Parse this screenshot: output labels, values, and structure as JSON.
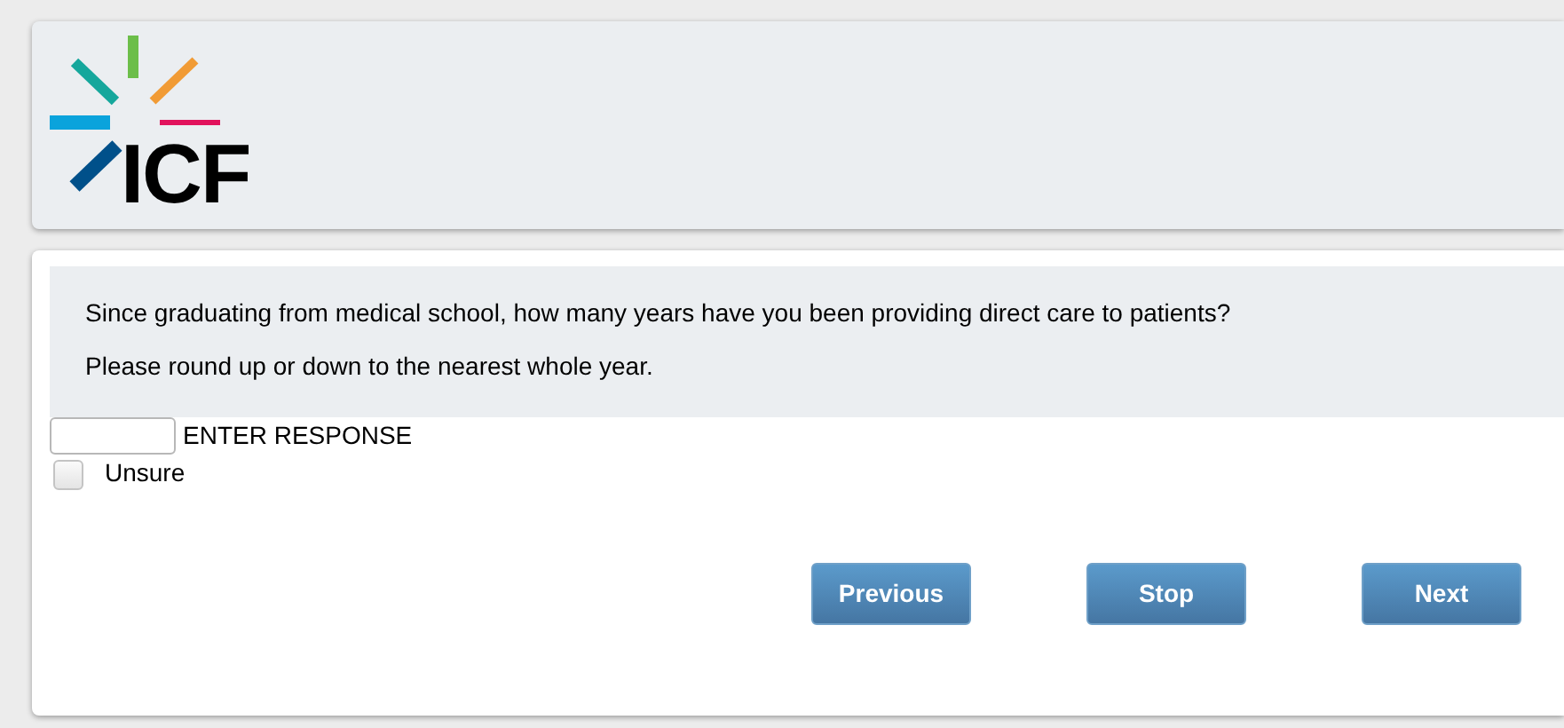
{
  "header": {
    "logo_text": "ICF"
  },
  "question": {
    "lines": [
      "Since graduating from medical school, how many years have you been providing direct care to patients?",
      "Please round up or down to the nearest whole year."
    ]
  },
  "response": {
    "label": "ENTER RESPONSE"
  },
  "options": [
    {
      "label": "Unsure",
      "checked": false
    }
  ],
  "buttons": [
    {
      "label": "Previous"
    },
    {
      "label": "Stop"
    },
    {
      "label": "Next"
    }
  ]
}
